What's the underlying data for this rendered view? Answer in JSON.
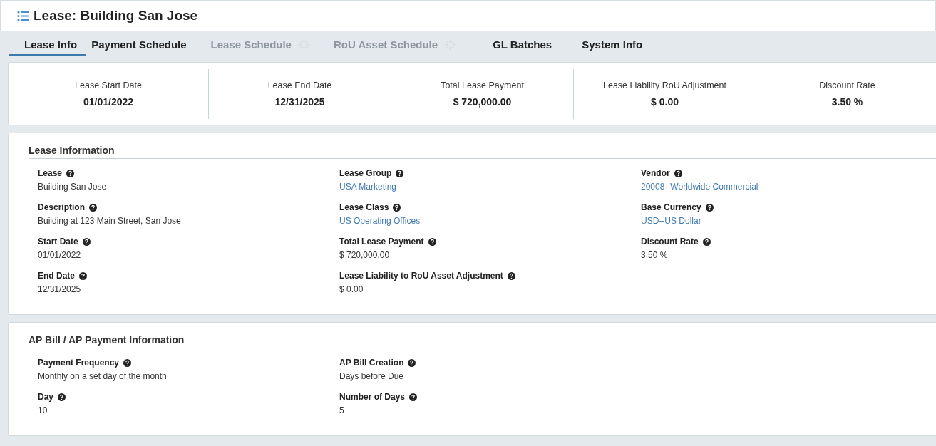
{
  "window": {
    "title": "Lease: Building San Jose"
  },
  "tabs": [
    {
      "label": "Lease Info",
      "selected": true,
      "disabled": false
    },
    {
      "label": "Payment Schedule",
      "selected": false,
      "disabled": false
    },
    {
      "label": "Lease Schedule",
      "selected": false,
      "disabled": true
    },
    {
      "label": "RoU Asset Schedule",
      "selected": false,
      "disabled": true
    },
    {
      "label": "GL Batches",
      "selected": false,
      "disabled": false
    },
    {
      "label": "System Info",
      "selected": false,
      "disabled": false
    }
  ],
  "summary": [
    {
      "label": "Lease Start Date",
      "value": "01/01/2022"
    },
    {
      "label": "Lease End Date",
      "value": "12/31/2025"
    },
    {
      "label": "Total Lease Payment",
      "value": "$ 720,000.00"
    },
    {
      "label": "Lease Liability RoU Adjustment",
      "value": "$ 0.00"
    },
    {
      "label": "Discount Rate",
      "value": "3.50 %"
    }
  ],
  "sections": [
    {
      "title": "Lease Information",
      "columns": [
        [
          {
            "label": "Lease",
            "value": "Building San Jose",
            "kind": "text"
          },
          {
            "label": "Description",
            "value": "Building at 123 Main Street, San Jose",
            "kind": "text"
          },
          {
            "label": "Start Date",
            "value": "01/01/2022",
            "kind": "text"
          },
          {
            "label": "End Date",
            "value": "12/31/2025",
            "kind": "text"
          }
        ],
        [
          {
            "label": "Lease Group",
            "value": "USA Marketing",
            "kind": "link"
          },
          {
            "label": "Lease Class",
            "value": "US Operating Offices",
            "kind": "link"
          },
          {
            "label": "Total Lease Payment",
            "value": "$ 720,000.00",
            "kind": "text"
          },
          {
            "label": "Lease Liability to RoU Asset Adjustment",
            "value": "$ 0.00",
            "kind": "text"
          }
        ],
        [
          {
            "label": "Vendor",
            "value": "20008--Worldwide Commercial",
            "kind": "link"
          },
          {
            "label": "Base Currency",
            "value": "USD--US Dollar",
            "kind": "link"
          },
          {
            "label": "Discount Rate",
            "value": "3.50 %",
            "kind": "text"
          }
        ]
      ]
    },
    {
      "title": "AP Bill / AP Payment Information",
      "columns": [
        [
          {
            "label": "Payment Frequency",
            "value": "Monthly on a set day of the month",
            "kind": "text"
          },
          {
            "label": "Day",
            "value": "10",
            "kind": "text"
          }
        ],
        [
          {
            "label": "AP Bill Creation",
            "value": "Days before Due",
            "kind": "text"
          },
          {
            "label": "Number of Days",
            "value": "5",
            "kind": "text"
          }
        ],
        []
      ]
    }
  ]
}
